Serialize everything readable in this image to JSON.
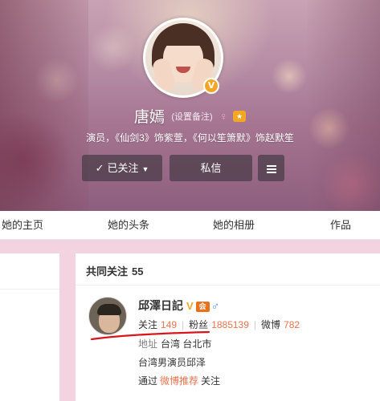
{
  "profile": {
    "name": "唐嫣",
    "remark_label": "(设置备注)",
    "bio": "演员，《仙剑3》饰紫萱，《何以笙箫默》饰赵默笙",
    "verified_badge": "V",
    "icons": [
      "female-icon",
      "vip-icon"
    ]
  },
  "actions": {
    "follow_label": "已关注",
    "message_label": "私信"
  },
  "tabs": [
    {
      "label": "她的主页"
    },
    {
      "label": "她的头条"
    },
    {
      "label": "她的相册"
    },
    {
      "label": "作品"
    }
  ],
  "common_follows": {
    "title": "共同关注",
    "count": "55",
    "user": {
      "name": "邱澤日記",
      "v_badge": "V",
      "vip_badge": "会",
      "follow_label": "关注",
      "follow_count": "149",
      "fans_label": "粉丝",
      "fans_count": "1885139",
      "weibo_label": "微博",
      "weibo_count": "782",
      "location_label": "地址",
      "location": "台湾 台北市",
      "description": "台湾男演员邱泽",
      "via_prefix": "通过",
      "via_link": "微博推荐",
      "via_suffix": "关注"
    }
  },
  "colors": {
    "accent_orange": "#eb7350",
    "pink_background": "#f3d3e0",
    "annotation_red": "#d8141c"
  }
}
